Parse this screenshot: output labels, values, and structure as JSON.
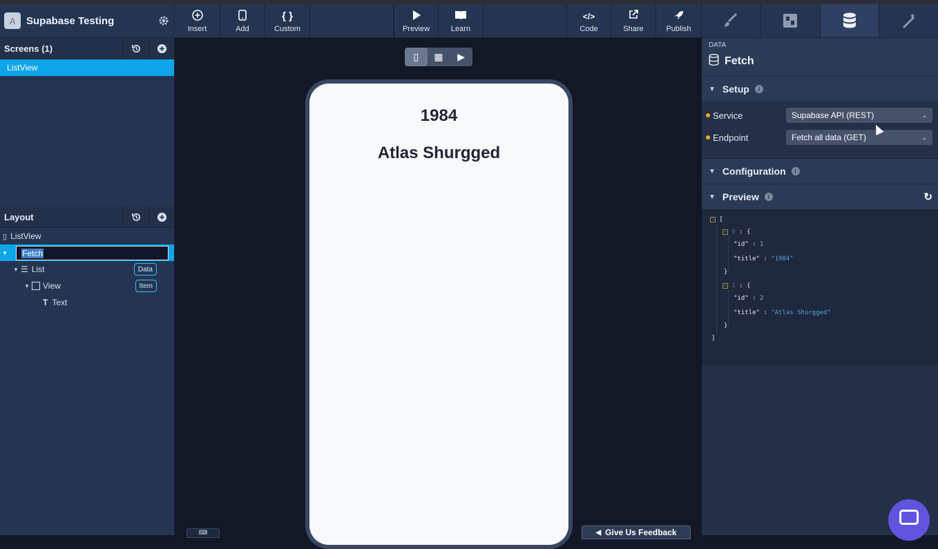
{
  "app": {
    "logo": "A",
    "title": "Supabase Testing"
  },
  "screens": {
    "title": "Screens (1)",
    "items": [
      "ListView"
    ]
  },
  "layout": {
    "title": "Layout",
    "tree": {
      "root": "ListView",
      "fetch_input": "Fetch",
      "list": "List",
      "list_badge": "Data",
      "view": "View",
      "view_badge": "Item",
      "text": "Text"
    }
  },
  "toolbar": {
    "insert": "Insert",
    "add": "Add",
    "custom": "Custom",
    "preview": "Preview",
    "learn": "Learn",
    "code": "Code",
    "share": "Share",
    "publish": "Publish"
  },
  "canvas": {
    "items": [
      "1984",
      "Atlas Shurgged"
    ],
    "feedback": "Give Us Feedback"
  },
  "panel": {
    "category": "DATA",
    "title": "Fetch",
    "setup": "Setup",
    "service_label": "Service",
    "service_value": "Supabase API (REST)",
    "endpoint_label": "Endpoint",
    "endpoint_value": "Fetch all data (GET)",
    "configuration": "Configuration",
    "preview": "Preview"
  },
  "preview_json": [
    {
      "index": "0",
      "id": "1",
      "title": "\"1984\""
    },
    {
      "index": "1",
      "id": "2",
      "title": "\"Atlas Shurgged\""
    }
  ],
  "colors": {
    "accent": "#0ea5e9",
    "panel": "#253551",
    "canvas": "#121826",
    "required_dot": "#f5a623",
    "chat": "#6153e0"
  }
}
